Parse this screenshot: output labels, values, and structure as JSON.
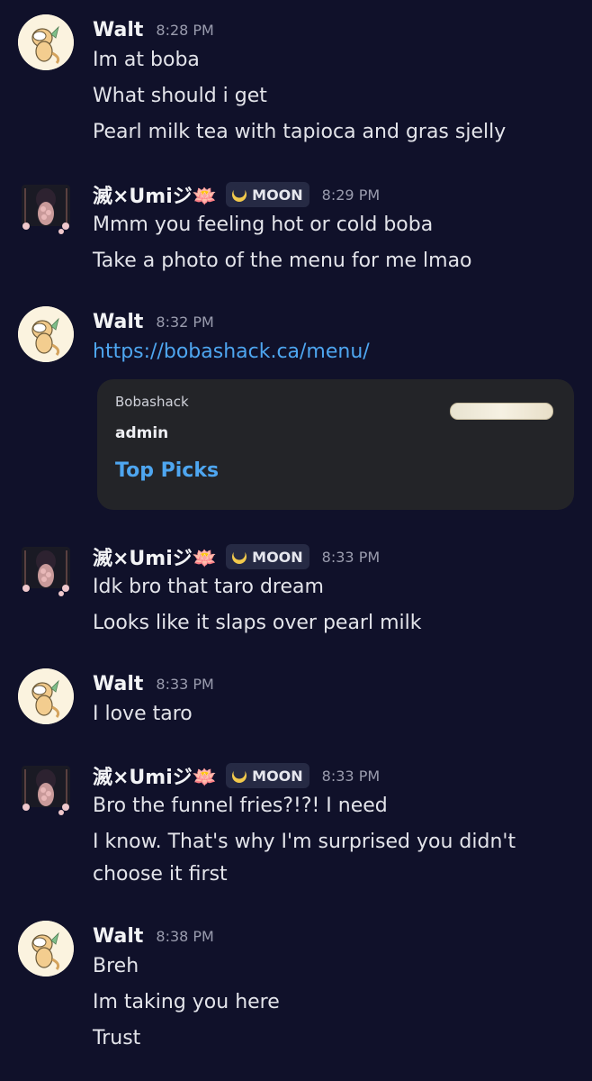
{
  "messages": [
    {
      "user": "Walt",
      "time": "8:28 PM",
      "lines": [
        "Im at boba",
        "What should i get",
        "Pearl milk tea with tapioca and gras sjelly"
      ]
    },
    {
      "user": "滅×Umiジ🪷",
      "badge": "MOON",
      "time": "8:29 PM",
      "lines": [
        "Mmm you feeling hot or cold boba",
        "Take a photo of the menu for me lmao"
      ]
    },
    {
      "user": "Walt",
      "time": "8:32 PM",
      "lines": [
        "https://bobashack.ca/menu/"
      ],
      "embed": {
        "provider": "Bobashack",
        "author": "admin",
        "title": "Top Picks"
      }
    },
    {
      "user": "滅×Umiジ🪷",
      "badge": "MOON",
      "time": "8:33 PM",
      "lines": [
        "Idk bro that taro dream",
        "Looks like it slaps over pearl milk"
      ]
    },
    {
      "user": "Walt",
      "time": "8:33 PM",
      "lines": [
        "I love taro"
      ]
    },
    {
      "user": "滅×Umiジ🪷",
      "badge": "MOON",
      "time": "8:33 PM",
      "lines": [
        "Bro the funnel fries?!?! I need",
        "I know. That's why I'm surprised you didn't",
        "choose it first"
      ]
    },
    {
      "user": "Walt",
      "time": "8:38 PM",
      "lines": [
        "Breh",
        "Im taking you here",
        "Trust"
      ]
    }
  ],
  "colors": {
    "background": "#10112a",
    "link": "#4ea6f0",
    "timestamp": "#9a9cae",
    "badge_bg": "#262a44"
  }
}
